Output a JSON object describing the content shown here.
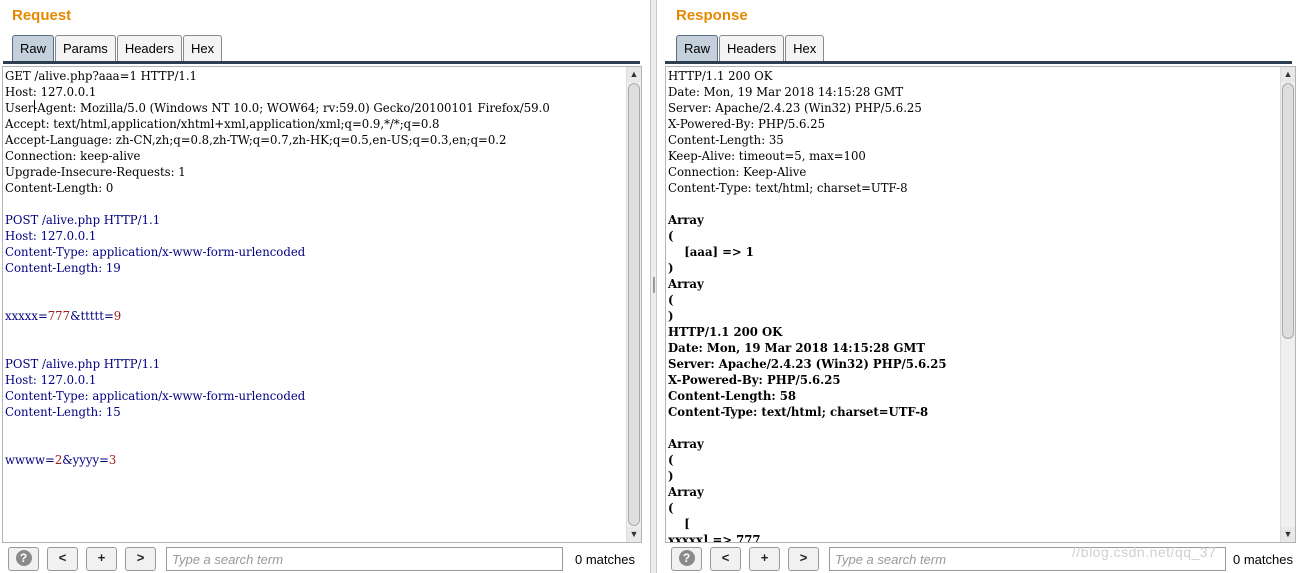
{
  "request": {
    "title": "Request",
    "tabs": [
      {
        "label": "Raw",
        "active": true
      },
      {
        "label": "Params",
        "active": false
      },
      {
        "label": "Headers",
        "active": false
      },
      {
        "label": "Hex",
        "active": false
      }
    ],
    "lines": [
      [
        {
          "t": "GET /alive.php?aaa=1 HTTP/1.1"
        }
      ],
      [
        {
          "t": "Host: 127.0.0.1"
        }
      ],
      [
        {
          "t": "User-Agent: Mozilla/5.0 (Windows NT 10.0; WOW64; rv:59.0) Gecko/20100101 Firefox/59.0"
        }
      ],
      [
        {
          "t": "Accept: text/html,application/xhtml+xml,application/xml;q=0.9,*/*;q=0.8"
        }
      ],
      [
        {
          "t": "Accept-Language: zh-CN,zh;q=0.8,zh-TW;q=0.7,zh-HK;q=0.5,en-US;q=0.3,en;q=0.2"
        }
      ],
      [
        {
          "t": "Connection: keep-alive"
        }
      ],
      [
        {
          "t": "Upgrade-Insecure-Requests: 1"
        }
      ],
      [
        {
          "t": "Content-Length: 0"
        }
      ],
      [],
      [
        {
          "t": "POST /alive.php HTTP/1.1",
          "c": "blue"
        }
      ],
      [
        {
          "t": "Host: 127.0.0.1",
          "c": "blue"
        }
      ],
      [
        {
          "t": "Content-Type: application/x-www-form-urlencoded",
          "c": "blue"
        }
      ],
      [
        {
          "t": "Content-Length: 19",
          "c": "blue"
        }
      ],
      [],
      [],
      [
        {
          "t": "xxxxx=",
          "c": "blue"
        },
        {
          "t": "777",
          "c": "red"
        },
        {
          "t": "&ttttt=",
          "c": "blue"
        },
        {
          "t": "9",
          "c": "red"
        }
      ],
      [],
      [],
      [
        {
          "t": "POST /alive.php HTTP/1.1",
          "c": "blue"
        }
      ],
      [
        {
          "t": "Host: 127.0.0.1",
          "c": "blue"
        }
      ],
      [
        {
          "t": "Content-Type: application/x-www-form-urlencoded",
          "c": "blue"
        }
      ],
      [
        {
          "t": "Content-Length: 15",
          "c": "blue"
        }
      ],
      [],
      [],
      [
        {
          "t": "wwww=",
          "c": "blue"
        },
        {
          "t": "2",
          "c": "red"
        },
        {
          "t": "&yyyy=",
          "c": "blue"
        },
        {
          "t": "3",
          "c": "red"
        }
      ]
    ],
    "search": {
      "placeholder": "Type a search term",
      "value": "",
      "matches": "0 matches"
    },
    "buttons": {
      "help": "?",
      "prev": "<",
      "add": "+",
      "next": ">"
    }
  },
  "response": {
    "title": "Response",
    "tabs": [
      {
        "label": "Raw",
        "active": true
      },
      {
        "label": "Headers",
        "active": false
      },
      {
        "label": "Hex",
        "active": false
      }
    ],
    "lines": [
      [
        {
          "t": "HTTP/1.1 200 OK"
        }
      ],
      [
        {
          "t": "Date: Mon, 19 Mar 2018 14:15:28 GMT"
        }
      ],
      [
        {
          "t": "Server: Apache/2.4.23 (Win32) PHP/5.6.25"
        }
      ],
      [
        {
          "t": "X-Powered-By: PHP/5.6.25"
        }
      ],
      [
        {
          "t": "Content-Length: 35"
        }
      ],
      [
        {
          "t": "Keep-Alive: timeout=5, max=100"
        }
      ],
      [
        {
          "t": "Connection: Keep-Alive"
        }
      ],
      [
        {
          "t": "Content-Type: text/html; charset=UTF-8"
        }
      ],
      [],
      [
        {
          "t": "Array",
          "b": true
        }
      ],
      [
        {
          "t": "(",
          "b": true
        }
      ],
      [
        {
          "t": "    [aaa] => 1",
          "b": true
        }
      ],
      [
        {
          "t": ")",
          "b": true
        }
      ],
      [
        {
          "t": "Array",
          "b": true
        }
      ],
      [
        {
          "t": "(",
          "b": true
        }
      ],
      [
        {
          "t": ")",
          "b": true
        }
      ],
      [
        {
          "t": "HTTP/1.1 200 OK",
          "b": true
        }
      ],
      [
        {
          "t": "Date: Mon, 19 Mar 2018 14:15:28 GMT",
          "b": true
        }
      ],
      [
        {
          "t": "Server: Apache/2.4.23 (Win32) PHP/5.6.25",
          "b": true
        }
      ],
      [
        {
          "t": "X-Powered-By: PHP/5.6.25",
          "b": true
        }
      ],
      [
        {
          "t": "Content-Length: 58",
          "b": true
        }
      ],
      [
        {
          "t": "Content-Type: text/html; charset=UTF-8",
          "b": true
        }
      ],
      [],
      [
        {
          "t": "Array",
          "b": true
        }
      ],
      [
        {
          "t": "(",
          "b": true
        }
      ],
      [
        {
          "t": ")",
          "b": true
        }
      ],
      [
        {
          "t": "Array",
          "b": true
        }
      ],
      [
        {
          "t": "(",
          "b": true
        }
      ],
      [
        {
          "t": "    [",
          "b": true
        }
      ],
      [
        {
          "t": "xxxxx] => 777",
          "b": true
        }
      ]
    ],
    "search": {
      "placeholder": "Type a search term",
      "value": "",
      "matches": "0 matches"
    },
    "buttons": {
      "help": "?",
      "prev": "<",
      "add": "+",
      "next": ">"
    }
  },
  "watermark": "//blog.csdn.net/qq_37"
}
